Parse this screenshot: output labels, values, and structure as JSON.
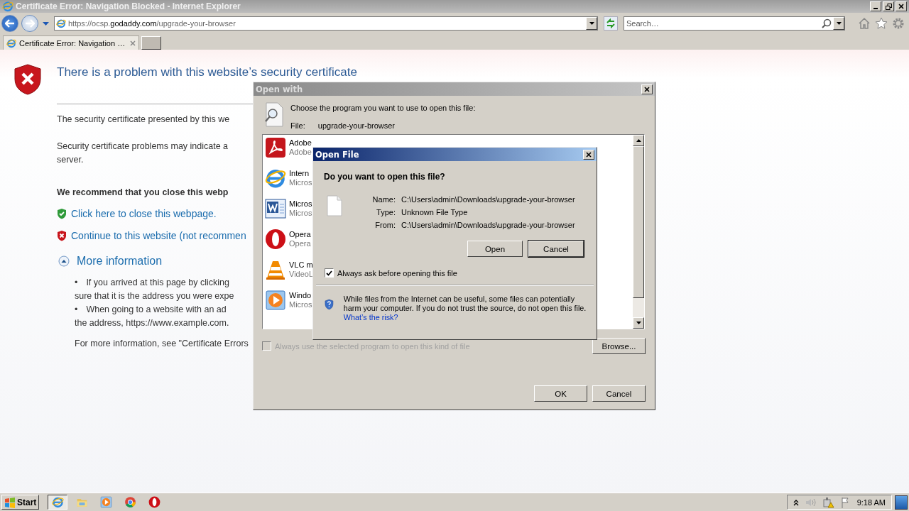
{
  "window": {
    "title": "Certificate Error: Navigation Blocked - Internet Explorer"
  },
  "address_bar": {
    "url": "https://ocsp.**godaddy.com**/upgrade-your-browser"
  },
  "search": {
    "placeholder": "Search…"
  },
  "tabs": [
    {
      "label": "Certificate Error: Navigation …",
      "selected": true
    }
  ],
  "page": {
    "heading": "There is a problem with this website’s security certificate",
    "paragraphs": [
      {
        "lines": [
          "The security certificate presented by this we"
        ]
      },
      {
        "lines": [
          "Security certificate problems may indicate a",
          "server."
        ]
      }
    ],
    "recommendation": "We recommend that you close this webp",
    "links": [
      {
        "kind": "safe",
        "text": "Click here to close this webpage."
      },
      {
        "kind": "unsafe",
        "text": "Continue to this website (not recommen"
      }
    ],
    "more_info": {
      "label": "More information",
      "expanded": true
    },
    "bullets": [
      {
        "marker": "•",
        "lines": [
          "If you arrived at this page by clicking",
          "sure that it is the address you were expe"
        ]
      },
      {
        "marker": "•",
        "lines": [
          "When going to a website with an ad",
          "the address, https://www.example.com."
        ]
      }
    ],
    "footer": "For more information, see \"Certificate Errors"
  },
  "open_with": {
    "title": "Open with",
    "prompt": "Choose the program you want to use to open this file:",
    "file_label": "File:",
    "file_name": "upgrade-your-browser",
    "programs": [
      {
        "kind": "pdf",
        "name": "Adobe",
        "publisher": "Adobe"
      },
      {
        "kind": "ie",
        "name": "Intern",
        "publisher": "Micros"
      },
      {
        "kind": "word",
        "name": "Micros",
        "publisher": "Micros"
      },
      {
        "kind": "opera",
        "name": "Opera",
        "publisher": "Opera"
      },
      {
        "kind": "vlc",
        "name": "VLC m",
        "publisher": "VideoL"
      },
      {
        "kind": "media",
        "name": "Windo",
        "publisher": "Micros"
      }
    ],
    "always_use": {
      "label": "Always use the selected program to open this kind of file",
      "checked": false,
      "disabled": true
    },
    "browse": "Browse...",
    "ok": "OK",
    "cancel": "Cancel"
  },
  "open_file": {
    "title": "Open File",
    "question": "Do you want to open this file?",
    "fields": [
      {
        "label": "Name:",
        "value": "C:\\Users\\admin\\Downloads\\upgrade-your-browser"
      },
      {
        "label": "Type:",
        "value": "Unknown File Type"
      },
      {
        "label": "From:",
        "value": "C:\\Users\\admin\\Downloads\\upgrade-your-browser"
      }
    ],
    "buttons": [
      {
        "label": "Open",
        "default": false
      },
      {
        "label": "Cancel",
        "default": true
      }
    ],
    "always_ask": {
      "label": "Always ask before opening this file",
      "checked": true
    },
    "warning": "While files from the Internet can be useful, some files can potentially harm your computer. If you do not trust the source, do not open this file.",
    "risk_link": "What’s the risk?"
  },
  "taskbar": {
    "start": "Start",
    "apps": [
      {
        "kind": "ie",
        "selected": true
      },
      {
        "kind": "folder",
        "selected": false
      },
      {
        "kind": "media",
        "selected": false
      },
      {
        "kind": "chrome",
        "selected": false
      },
      {
        "kind": "opera",
        "selected": false
      }
    ],
    "clock": "9:18 AM"
  }
}
